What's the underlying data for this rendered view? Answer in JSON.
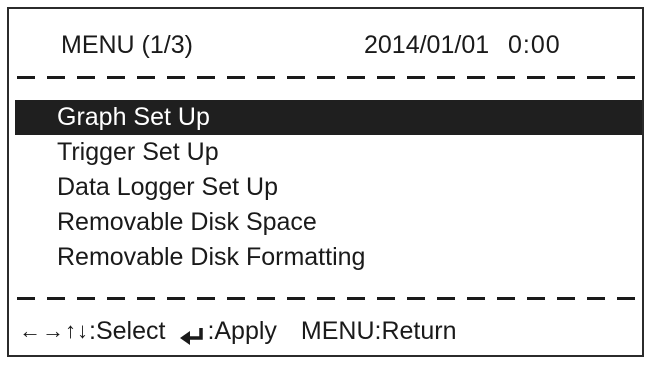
{
  "header": {
    "title": "MENU (1/3)",
    "date": "2014/01/01",
    "time": "0:00"
  },
  "menu": {
    "items": [
      {
        "label": "Graph Set Up",
        "selected": true
      },
      {
        "label": "Trigger Set Up",
        "selected": false
      },
      {
        "label": "Data Logger Set Up",
        "selected": false
      },
      {
        "label": "Removable Disk Space",
        "selected": false
      },
      {
        "label": "Removable Disk Formatting",
        "selected": false
      }
    ]
  },
  "footer": {
    "nav_keys": "←→↑↓",
    "select_label": ":Select",
    "enter_icon": "enter-icon",
    "apply_label": ":Apply",
    "return_label": "MENU:Return"
  },
  "colors": {
    "highlight_bg": "#1f1f1f",
    "highlight_text": "#ffffff",
    "text": "#1a1a1a",
    "background": "#ffffff"
  }
}
